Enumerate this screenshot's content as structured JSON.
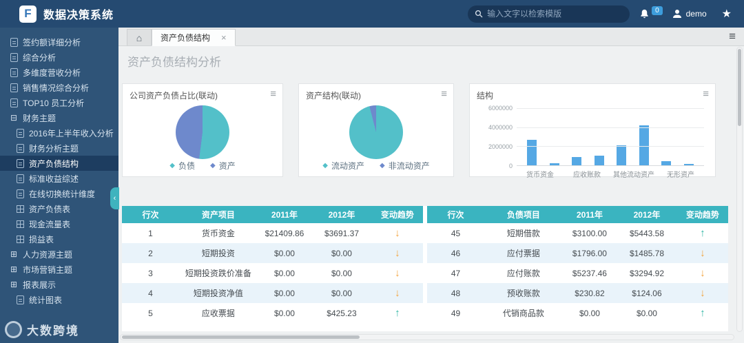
{
  "app": {
    "title": "数据决策系统",
    "search_placeholder": "输入文字以检索模版",
    "notification_count": "0",
    "username": "demo"
  },
  "icons": {
    "home": "⌂",
    "hamburger": "≡",
    "close": "×",
    "card_menu": "≡",
    "collapse": "‹",
    "star": "★"
  },
  "sidebar": {
    "items": [
      {
        "label": "签约额详细分析",
        "icon": "report",
        "level": 0,
        "selected": false
      },
      {
        "label": "综合分析",
        "icon": "report",
        "level": 0,
        "selected": false
      },
      {
        "label": "多维度营收分析",
        "icon": "report",
        "level": 0,
        "selected": false
      },
      {
        "label": "销售情况综合分析",
        "icon": "report",
        "level": 0,
        "selected": false
      },
      {
        "label": "TOP10 员工分析",
        "icon": "report",
        "level": 0,
        "selected": false
      },
      {
        "label": "财务主题",
        "icon": "minus",
        "level": 0,
        "selected": false
      },
      {
        "label": "2016年上半年收入分析",
        "icon": "report",
        "level": 1,
        "selected": false
      },
      {
        "label": "财务分析主题",
        "icon": "report",
        "level": 1,
        "selected": false
      },
      {
        "label": "资产负债结构",
        "icon": "report",
        "level": 1,
        "selected": true
      },
      {
        "label": "标准收益综述",
        "icon": "report",
        "level": 1,
        "selected": false
      },
      {
        "label": "在线切换统计维度",
        "icon": "report",
        "level": 1,
        "selected": false
      },
      {
        "label": "资产负债表",
        "icon": "sheet",
        "level": 1,
        "selected": false
      },
      {
        "label": "现金流量表",
        "icon": "sheet",
        "level": 1,
        "selected": false
      },
      {
        "label": "损益表",
        "icon": "sheet",
        "level": 1,
        "selected": false
      },
      {
        "label": "人力资源主题",
        "icon": "plus",
        "level": 0,
        "selected": false
      },
      {
        "label": "市场营销主题",
        "icon": "plus",
        "level": 0,
        "selected": false
      },
      {
        "label": "报表展示",
        "icon": "plus",
        "level": 0,
        "selected": false
      },
      {
        "label": "统计图表",
        "icon": "report",
        "level": 1,
        "selected": false
      }
    ]
  },
  "tabs": {
    "items": [
      {
        "label": "资产负债结构"
      }
    ]
  },
  "page": {
    "heading": "资产负债结构分析"
  },
  "watermark": {
    "text": "大数跨境"
  },
  "chart_data": [
    {
      "type": "pie",
      "title": "公司资产负债占比(联动)",
      "legend_position": "bottom",
      "series": [
        {
          "name": "负债",
          "value": 52,
          "color": "#53c0c9"
        },
        {
          "name": "资产",
          "value": 48,
          "color": "#6e89cc"
        }
      ]
    },
    {
      "type": "pie",
      "title": "资产结构(联动)",
      "legend_position": "bottom",
      "series": [
        {
          "name": "流动资产",
          "value": 96,
          "color": "#53c0c9"
        },
        {
          "name": "非流动资产",
          "value": 4,
          "color": "#6e89cc"
        }
      ]
    },
    {
      "type": "bar",
      "title": "结构",
      "bar_color": "#55a8e4",
      "values": [
        2700000,
        250000,
        900000,
        1000000,
        2100000,
        4200000,
        450000,
        150000
      ],
      "xlabels": [
        "货币资金",
        "应收账款",
        "其他流动资产",
        "无形资产"
      ],
      "yticks": [
        6000000,
        4000000,
        2000000,
        0
      ],
      "ylim": [
        0,
        6000000
      ],
      "grid": true
    }
  ],
  "trend_glyphs": {
    "up": "↑",
    "down": "↓"
  },
  "trend_colors": {
    "up": "#2db5a3",
    "down": "#f2a33c"
  },
  "tables": [
    {
      "headers": [
        "行次",
        "资产项目",
        "2011年",
        "2012年",
        "变动趋势"
      ],
      "rows": [
        {
          "cells": [
            "1",
            "货币资金",
            "$21409.86",
            "$3691.37"
          ],
          "trend": "down"
        },
        {
          "cells": [
            "2",
            "短期投资",
            "$0.00",
            "$0.00"
          ],
          "trend": "down"
        },
        {
          "cells": [
            "3",
            "短期投资跌价准备",
            "$0.00",
            "$0.00"
          ],
          "trend": "down"
        },
        {
          "cells": [
            "4",
            "短期投资净值",
            "$0.00",
            "$0.00"
          ],
          "trend": "down"
        },
        {
          "cells": [
            "5",
            "应收票据",
            "$0.00",
            "$425.23"
          ],
          "trend": "up"
        }
      ]
    },
    {
      "headers": [
        "行次",
        "负债项目",
        "2011年",
        "2012年",
        "变动趋势"
      ],
      "rows": [
        {
          "cells": [
            "45",
            "短期借款",
            "$3100.00",
            "$5443.58"
          ],
          "trend": "up"
        },
        {
          "cells": [
            "46",
            "应付票据",
            "$1796.00",
            "$1485.78"
          ],
          "trend": "down"
        },
        {
          "cells": [
            "47",
            "应付账款",
            "$5237.46",
            "$3294.92"
          ],
          "trend": "down"
        },
        {
          "cells": [
            "48",
            "预收账款",
            "$230.82",
            "$124.06"
          ],
          "trend": "down"
        },
        {
          "cells": [
            "49",
            "代销商品款",
            "$0.00",
            "$0.00"
          ],
          "trend": "up"
        }
      ]
    }
  ]
}
